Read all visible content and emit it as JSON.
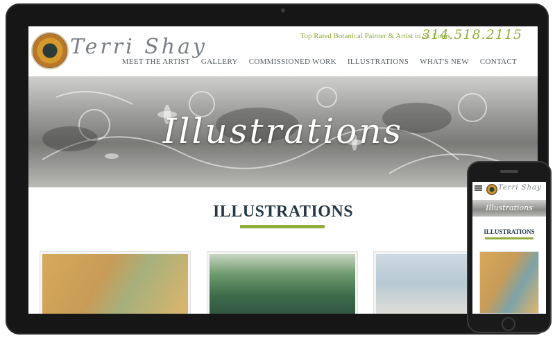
{
  "header": {
    "logo_text": "Terri Shay",
    "tagline": "Top Rated Botanical Painter & Artist in St. Louis",
    "phone": "314.518.2115"
  },
  "nav": {
    "items": [
      {
        "label": "MEET THE ARTIST"
      },
      {
        "label": "GALLERY"
      },
      {
        "label": "COMMISSIONED WORK"
      },
      {
        "label": "ILLUSTRATIONS"
      },
      {
        "label": "WHAT'S NEW"
      },
      {
        "label": "CONTACT"
      }
    ]
  },
  "hero": {
    "title": "Illustrations"
  },
  "section": {
    "title": "ILLUSTRATIONS"
  },
  "mobile": {
    "logo_text": "Terri Shay",
    "hero_title": "Illustrations",
    "section_title": "ILLUSTRATIONS"
  },
  "colors": {
    "accent_green": "#8fae3b",
    "heading_navy": "#243848",
    "nav_gray": "#555b60"
  }
}
